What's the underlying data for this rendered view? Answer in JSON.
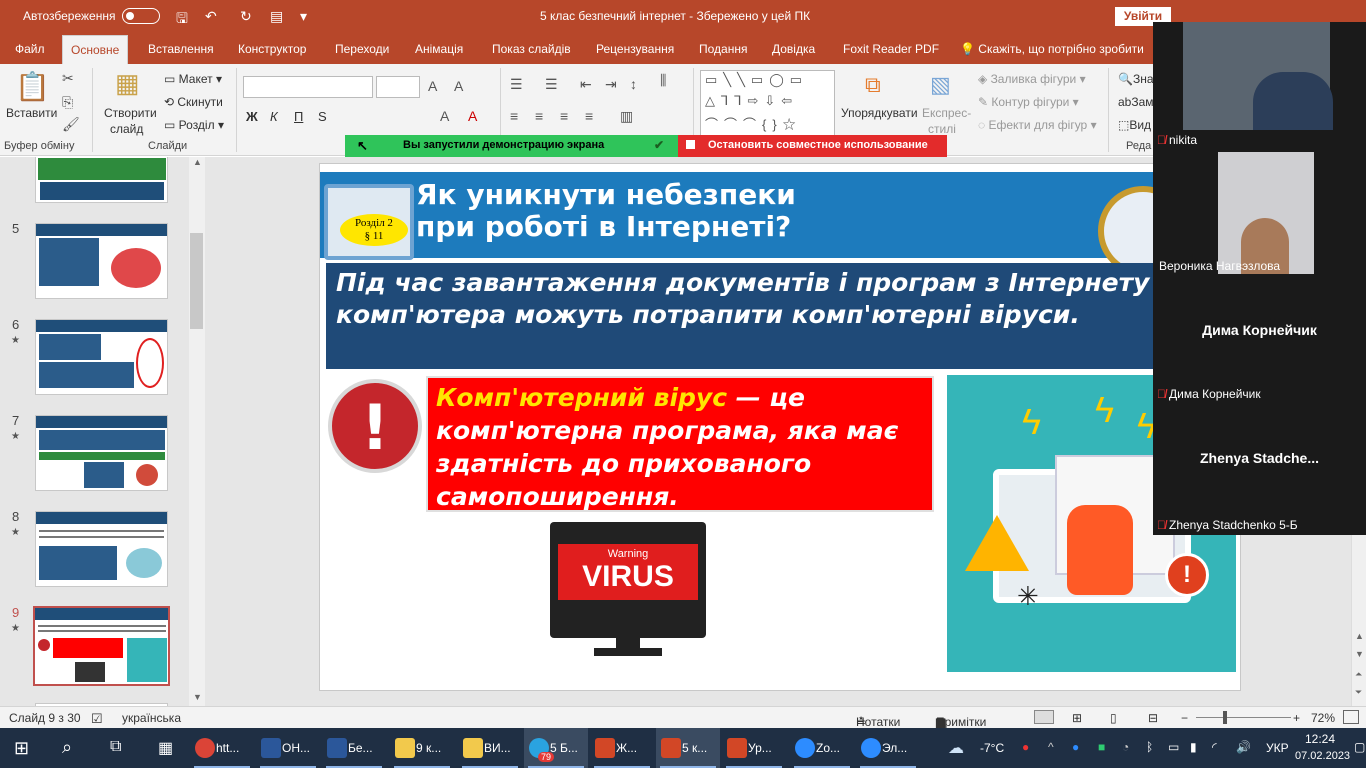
{
  "titlebar": {
    "autosave_label": "Автозбереження",
    "autosave_state": "off",
    "doc_title": "5 клас безпечний інтернет  -  Збережено у цей ПК",
    "signin_label": "Увійти"
  },
  "tabs": [
    "Файл",
    "Основне",
    "Вставлення",
    "Конструктор",
    "Переходи",
    "Анімація",
    "Показ слайдів",
    "Рецензування",
    "Подання",
    "Довідка",
    "Foxit Reader PDF",
    "Скажіть, що потрібно зробити"
  ],
  "active_tab": "Основне",
  "ribbon": {
    "paste": "Вставити",
    "clipboard_group": "Буфер обміну",
    "new_slide_1": "Створити",
    "new_slide_2": "слайд",
    "layout": "Макет",
    "reset": "Скинути",
    "section": "Розділ",
    "slides_group": "Слайди",
    "bold": "Ж",
    "italic": "К",
    "underline": "П",
    "strike": "S",
    "arrange": "Упорядкувати",
    "quick_styles_1": "Експрес-",
    "quick_styles_2": "стилі",
    "shape_fill": "Заливка фігури",
    "shape_outline": "Контур фігури",
    "shape_effects": "Ефекти для фігур",
    "find": "Зна",
    "replace": "Зам",
    "select": "Вид",
    "editing_group": "Реда"
  },
  "sharebar": {
    "sharing_msg": "Вы запустили демонстрацию экрана",
    "stop_msg": "Остановить совместное использование"
  },
  "thumbnails": [
    {
      "num": "5",
      "star": ""
    },
    {
      "num": "6",
      "star": "★"
    },
    {
      "num": "7",
      "star": "★"
    },
    {
      "num": "8",
      "star": "★"
    },
    {
      "num": "9",
      "star": "★"
    }
  ],
  "slide": {
    "title_line1": "Як уникнути небезпеки",
    "title_line2": "при роботі в Інтернеті?",
    "badge_line1": "Розділ 2",
    "badge_line2": "§ 11",
    "text_box": "Під час завантаження документів і програм з Інтернету до комп'ютера можуть потрапити комп'ютерні віруси.",
    "definition_term": "Комп'ютерний вірус",
    "definition_rest": " — це комп'ютерна програма, яка має здатність до прихованого самопоширення.",
    "virus_warning": "Warning",
    "virus_word": "VIRUS"
  },
  "participants": [
    {
      "name": "nikita",
      "video": true,
      "big": ""
    },
    {
      "name": "Вероника Нагвэзлова",
      "video": true,
      "big": ""
    },
    {
      "name": "Дима Корнейчик",
      "video": false,
      "big": "Дима Корнейчик"
    },
    {
      "name": "Zhenya Stadchenko 5-Б",
      "video": false,
      "big": "Zhenya  Stadche..."
    }
  ],
  "status": {
    "slide_counter": "Слайд 9 з 30",
    "language": "українська",
    "notes": "Нотатки",
    "comments": "Примітки",
    "zoom": "72%"
  },
  "taskbar": {
    "items": [
      {
        "label": "htt...",
        "color": "#db4437"
      },
      {
        "label": "ОН...",
        "color": "#2b579a"
      },
      {
        "label": "Бе...",
        "color": "#2b579a"
      },
      {
        "label": "9 к...",
        "color": "#f2c94c"
      },
      {
        "label": "ВИ...",
        "color": "#f2c94c"
      },
      {
        "label": "5 Б...",
        "color": "#2aa3e0"
      },
      {
        "label": "Ж...",
        "color": "#d24726"
      },
      {
        "label": "5 к...",
        "color": "#d24726"
      },
      {
        "label": "Ур...",
        "color": "#d24726"
      },
      {
        "label": "Zo...",
        "color": "#2d8cff"
      },
      {
        "label": "Эл...",
        "color": "#2d8cff"
      }
    ],
    "telegram_badge": "79",
    "weather": "-7°C",
    "lang": "УКР",
    "time": "12:24",
    "date": "07.02.2023"
  }
}
